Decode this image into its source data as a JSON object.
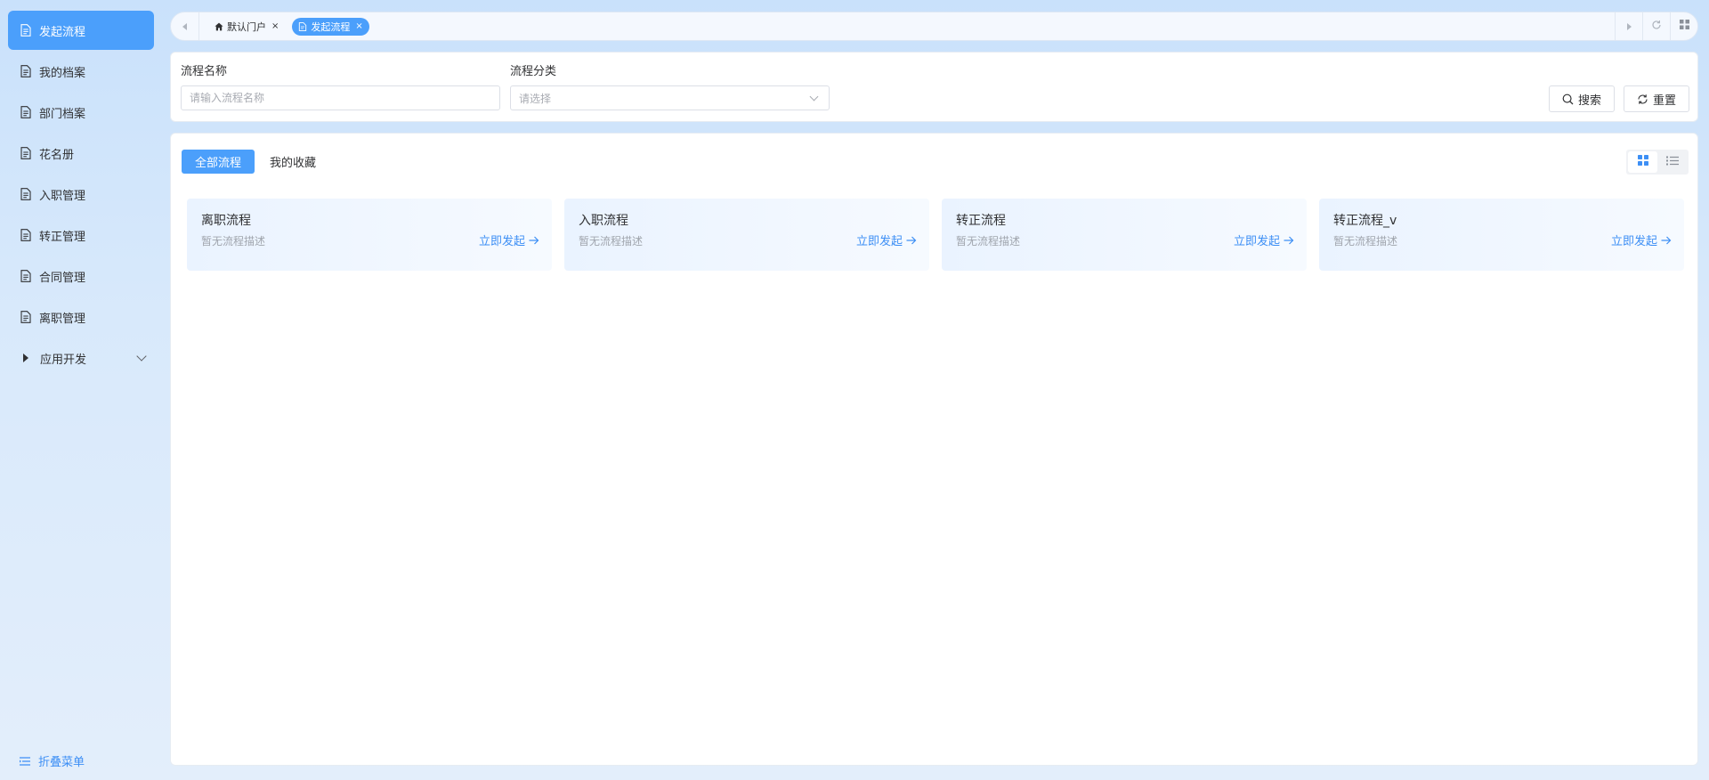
{
  "sidebar": {
    "items": [
      {
        "label": "发起流程",
        "active": true
      },
      {
        "label": "我的档案"
      },
      {
        "label": "部门档案"
      },
      {
        "label": "花名册"
      },
      {
        "label": "入职管理"
      },
      {
        "label": "转正管理"
      },
      {
        "label": "合同管理"
      },
      {
        "label": "离职管理"
      },
      {
        "label": "应用开发",
        "expandable": true
      }
    ],
    "collapse_label": "折叠菜单"
  },
  "tabbar": {
    "tabs": [
      {
        "label": "默认门户",
        "icon": "home-icon"
      },
      {
        "label": "发起流程",
        "icon": "document-icon",
        "active": true
      }
    ]
  },
  "search": {
    "name_label": "流程名称",
    "name_placeholder": "请输入流程名称",
    "category_label": "流程分类",
    "category_placeholder": "请选择",
    "search_button": "搜索",
    "reset_button": "重置"
  },
  "main": {
    "filter_tabs": [
      {
        "label": "全部流程",
        "active": true
      },
      {
        "label": "我的收藏"
      }
    ],
    "cards": [
      {
        "title": "离职流程",
        "desc": "暂无流程描述",
        "action": "立即发起"
      },
      {
        "title": "入职流程",
        "desc": "暂无流程描述",
        "action": "立即发起"
      },
      {
        "title": "转正流程",
        "desc": "暂无流程描述",
        "action": "立即发起"
      },
      {
        "title": "转正流程_v",
        "desc": "暂无流程描述",
        "action": "立即发起"
      }
    ]
  },
  "colors": {
    "accent": "#4b9ffb",
    "link": "#3d8ff5"
  }
}
